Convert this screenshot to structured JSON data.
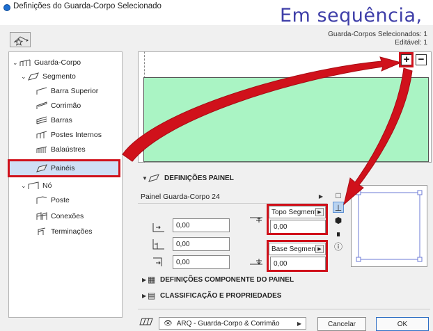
{
  "window": {
    "title": "Definições do Guarda-Corpo Selecionado"
  },
  "overlay_caption": "Em sequência,",
  "selection_info": {
    "count_line": "Guarda-Corpos Selecionados: 1",
    "editable_line": "Editável: 1"
  },
  "tree": [
    {
      "label": "Guarda-Corpo",
      "expanded": true,
      "icon": "railing-icon"
    },
    {
      "label": "Segmento",
      "expanded": true,
      "icon": "segment-icon"
    },
    {
      "label": "Barra Superior",
      "icon": "top-rail-icon"
    },
    {
      "label": "Corrimão",
      "icon": "handrail-icon"
    },
    {
      "label": "Barras",
      "icon": "rails-icon"
    },
    {
      "label": "Postes Internos",
      "icon": "inner-posts-icon"
    },
    {
      "label": "Balaústres",
      "icon": "balusters-icon"
    },
    {
      "label": "Painéis",
      "icon": "panels-icon",
      "selected": true
    },
    {
      "label": "Nó",
      "expanded": true,
      "icon": "node-icon"
    },
    {
      "label": "Poste",
      "icon": "post-icon"
    },
    {
      "label": "Conexões",
      "icon": "connections-icon"
    },
    {
      "label": "Terminações",
      "icon": "terminations-icon"
    }
  ],
  "preview": {
    "zoom_in": "+",
    "zoom_out": "−",
    "panel_color": "#aaf4c4"
  },
  "panel_section": {
    "title": "DEFINIÇÕES PAINEL",
    "panel_type": "Painel Guarda-Corpo 24",
    "top_label": "Topo Segmento",
    "top_value": "0,00",
    "base_label": "Base Segmento",
    "base_value": "0,00",
    "offset_1": "0,00",
    "offset_2": "0,00",
    "offset_3": "0,00"
  },
  "component_section": {
    "title": "DEFINIÇÕES COMPONENTE DO PAINEL"
  },
  "classification_section": {
    "title": "CLASSIFICAÇÃO E PROPRIEDADES"
  },
  "footer": {
    "layer": "ARQ - Guarda-Corpo & Corrimão",
    "cancel_label": "Cancelar",
    "ok_label": "OK"
  },
  "colors": {
    "highlight_red": "#d0111b",
    "panel_green": "#aaf4c4",
    "caption_blue": "#3e3ea8"
  }
}
